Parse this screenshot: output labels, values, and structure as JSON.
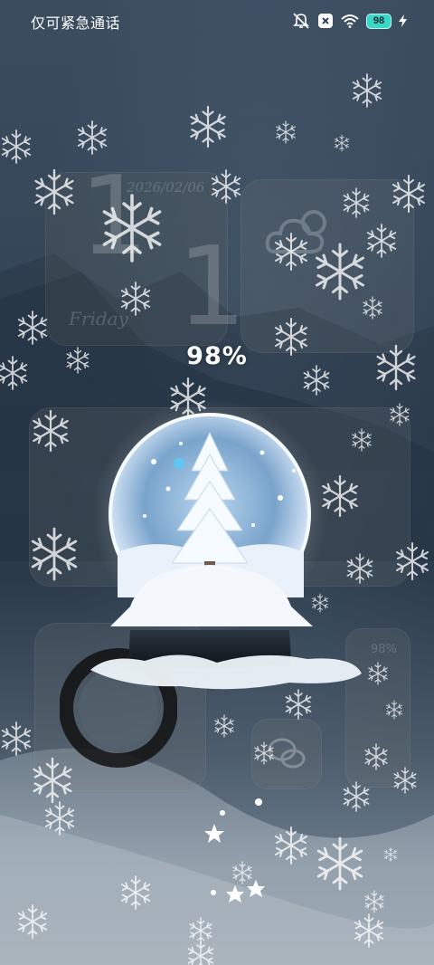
{
  "status_bar": {
    "carrier": "仅可紧急通话",
    "battery_level": "98",
    "icons": [
      "mute-icon",
      "no-sim-icon",
      "wifi-icon",
      "battery-icon",
      "charging-bolt-icon"
    ]
  },
  "lockscreen": {
    "charging_percent": "98%",
    "background_widgets": {
      "date": "2026/02/06",
      "day": "Friday",
      "widget_percent": "98%"
    }
  },
  "colors": {
    "battery_fill": "#3ad6c6",
    "background": "#324455"
  }
}
